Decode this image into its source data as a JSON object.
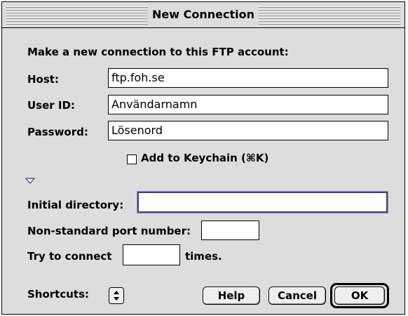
{
  "window": {
    "title": "New Connection"
  },
  "header": "Make a new connection to this FTP account:",
  "host": {
    "label": "Host:",
    "value": "ftp.foh.se"
  },
  "user_id": {
    "label": "User ID:",
    "value": "Användarnamn"
  },
  "password": {
    "label": "Password:",
    "value": "Lösenord"
  },
  "keychain": {
    "label": "Add to Keychain (⌘K)",
    "checked": false
  },
  "initial_directory": {
    "label": "Initial directory:",
    "value": ""
  },
  "port": {
    "label": "Non-standard port number:",
    "value": ""
  },
  "retries": {
    "label_before": "Try to connect",
    "label_after": "times.",
    "value": ""
  },
  "shortcuts": {
    "label": "Shortcuts:"
  },
  "buttons": {
    "help": "Help",
    "cancel": "Cancel",
    "ok": "OK"
  },
  "icons": {
    "disclosure": "disclosure-triangle-icon",
    "popup": "popup-arrows-icon"
  }
}
